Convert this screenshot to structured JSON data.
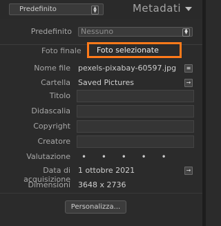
{
  "header": {
    "preset_value": "Predefinito",
    "panel_title": "Metadati"
  },
  "preset_row": {
    "label": "Predefinito",
    "value": "Nessuno"
  },
  "tabs": {
    "final_label": "Foto finale",
    "selected_label": "Foto selezionate"
  },
  "fields": {
    "filename_label": "Nome file",
    "filename_value": "pexels-pixabay-60597.jpg",
    "folder_label": "Cartella",
    "folder_value": "Saved Pictures",
    "title_label": "Titolo",
    "caption_label": "Didascalia",
    "copyright_label": "Copyright",
    "creator_label": "Creatore",
    "rating_label": "Valutazione",
    "rating_dots": "• • • • •",
    "capture_date_label": "Data di acquisizione",
    "capture_date_value": "1 ottobre 2021",
    "dimensions_label": "Dimensioni",
    "dimensions_value": "3648 x 2736"
  },
  "footer": {
    "customize_label": "Personalizza..."
  },
  "colors": {
    "highlight": "#ff7a1a",
    "background": "#2b2b2b"
  }
}
